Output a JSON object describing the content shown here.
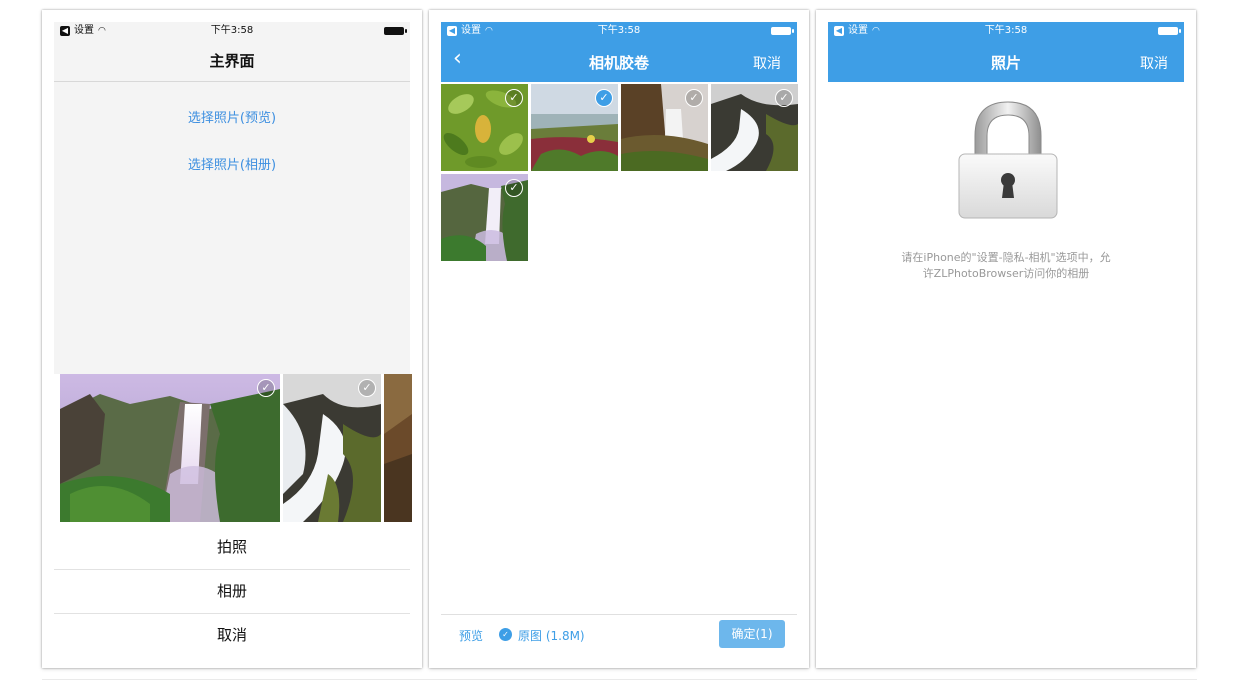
{
  "status_bar": {
    "back_app": "设置",
    "time": "下午3:58"
  },
  "screen_main": {
    "title": "主界面",
    "links": [
      "选择照片(预览)",
      "选择照片(相册)"
    ],
    "sheet_buttons": [
      "拍照",
      "相册",
      "取消"
    ]
  },
  "screen_album": {
    "title": "相机胶卷",
    "cancel": "取消",
    "preview": "预览",
    "original": "原图 (1.8M)",
    "confirm": "确定(1)"
  },
  "screen_denied": {
    "title": "照片",
    "cancel": "取消",
    "message_line1": "请在iPhone的\"设置-隐私-相机\"选项中，允",
    "message_line2": "许ZLPhotoBrowser访问你的相册"
  },
  "colors": {
    "accent": "#3e9ee6",
    "link": "#3d8fe0",
    "confirm_bg": "#6db7ec"
  },
  "icons": [
    "back-app-icon",
    "wifi-icon",
    "battery-icon",
    "chevron-left-icon",
    "check-icon",
    "lock-icon"
  ]
}
